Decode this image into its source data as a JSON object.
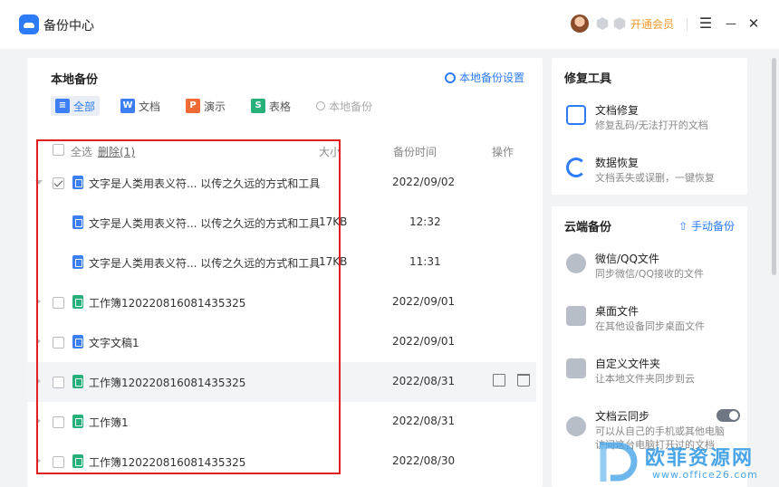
{
  "app": {
    "title": "备份中心",
    "vip_label": "开通会员"
  },
  "window": {
    "menu_glyph": "☰",
    "min_glyph": "—",
    "close_glyph": "✕"
  },
  "local_backup": {
    "title": "本地备份",
    "settings_label": "本地备份设置",
    "filters": [
      {
        "label": "全部",
        "icon": "list-icon",
        "color": "#3d7ef5",
        "active": true
      },
      {
        "label": "文档",
        "icon": "word-icon",
        "color": "#3d7ef5"
      },
      {
        "label": "演示",
        "icon": "ppt-icon",
        "color": "#f06a35"
      },
      {
        "label": "表格",
        "icon": "sheet-icon",
        "color": "#28b07a"
      },
      {
        "label": "本地备份",
        "icon": "search-icon"
      }
    ],
    "header": {
      "select_all": "全选",
      "delete": "删除(1)",
      "size": "大小",
      "time": "备份时间",
      "op": "操作"
    },
    "rows": [
      {
        "name": "文字是人类用表义符... 以传之久远的方式和工具",
        "size": "",
        "date": "2022/09/02",
        "type": "w",
        "checked": true,
        "expanded": true,
        "child": false
      },
      {
        "name": "文字是人类用表义符... 以传之久远的方式和工具",
        "size": "17KB",
        "date": "12:32",
        "type": "w",
        "child": true
      },
      {
        "name": "文字是人类用表义符... 以传之久远的方式和工具",
        "size": "17KB",
        "date": "11:31",
        "type": "w",
        "child": true
      },
      {
        "name": "工作簿120220816081435325",
        "size": "",
        "date": "2022/09/01",
        "type": "s",
        "child": false
      },
      {
        "name": "文字文稿1",
        "size": "",
        "date": "2022/09/01",
        "type": "w",
        "child": false
      },
      {
        "name": "工作簿120220816081435325",
        "size": "",
        "date": "2022/08/31",
        "type": "s",
        "child": false,
        "hover": true
      },
      {
        "name": "工作簿1",
        "size": "",
        "date": "2022/08/31",
        "type": "s",
        "child": false
      },
      {
        "name": "工作簿120220816081435325",
        "size": "",
        "date": "2022/08/30",
        "type": "s",
        "child": false
      }
    ]
  },
  "repair": {
    "title": "修复工具",
    "tools": [
      {
        "name": "文档修复",
        "desc": "修复乱码/无法打开的文档",
        "color": "#2d7cf6"
      },
      {
        "name": "数据恢复",
        "desc": "文档丢失或误删，一键恢复",
        "color": "#2d7cf6"
      }
    ]
  },
  "cloud": {
    "title": "云端备份",
    "action": "手动备份",
    "items": [
      {
        "name": "微信/QQ文件",
        "desc": "同步微信/QQ接收的文件"
      },
      {
        "name": "桌面文件",
        "desc": "在其他设备同步桌面文件"
      },
      {
        "name": "自定义文件夹",
        "desc": "让本地文件夹同步到云"
      },
      {
        "name": "文档云同步",
        "desc": "可以从自己的手机或其他电脑",
        "desc2": "访问这台电脑打开过的文档"
      }
    ]
  },
  "watermark": {
    "text": "欧菲资源网",
    "url": "www.office26.com"
  }
}
